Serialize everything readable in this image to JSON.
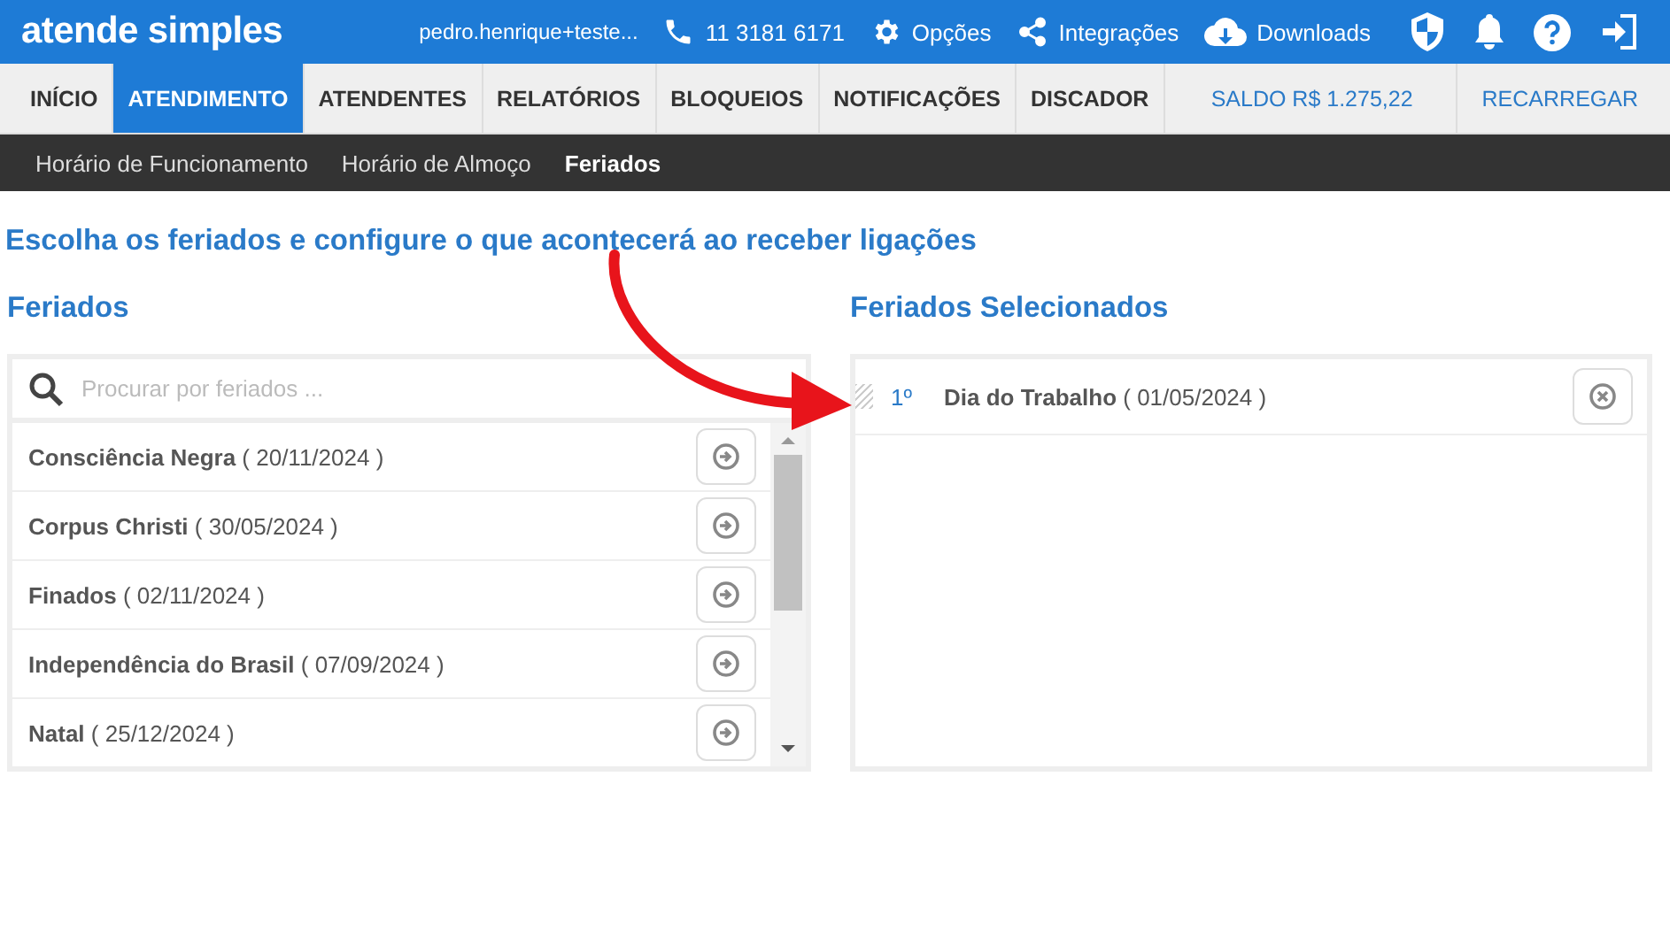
{
  "header": {
    "logo": "atende simples",
    "user": "pedro.henrique+teste...",
    "phone": "11 3181 6171",
    "links": [
      {
        "kind": "options",
        "label": "Opções"
      },
      {
        "kind": "integrations",
        "label": "Integrações"
      },
      {
        "kind": "downloads",
        "label": "Downloads"
      }
    ]
  },
  "nav": {
    "tabs": [
      {
        "label": "INÍCIO",
        "selected": false
      },
      {
        "label": "ATENDIMENTO",
        "selected": true
      },
      {
        "label": "ATENDENTES",
        "selected": false
      },
      {
        "label": "RELATÓRIOS",
        "selected": false
      },
      {
        "label": "BLOQUEIOS",
        "selected": false
      },
      {
        "label": "NOTIFICAÇÕES",
        "selected": false
      },
      {
        "label": "DISCADOR",
        "selected": false
      }
    ],
    "balance": "SALDO R$ 1.275,22",
    "recharge": "RECARREGAR"
  },
  "subnav": [
    {
      "label": "Horário de Funcionamento",
      "selected": false
    },
    {
      "label": "Horário de Almoço",
      "selected": false
    },
    {
      "label": "Feriados",
      "selected": true
    }
  ],
  "heading": "Escolha os feriados e configure o que acontecerá ao receber ligações",
  "holidays": {
    "title": "Feriados",
    "search": {
      "placeholder": "Procurar por feriados ..."
    },
    "items": [
      {
        "name": "Consciência Negra",
        "date": "( 20/11/2024 )"
      },
      {
        "name": "Corpus Christi",
        "date": "( 30/05/2024 )"
      },
      {
        "name": "Finados",
        "date": "( 02/11/2024 )"
      },
      {
        "name": "Independência do Brasil",
        "date": "( 07/09/2024 )"
      },
      {
        "name": "Natal",
        "date": "( 25/12/2024 )"
      }
    ]
  },
  "selected_holidays": {
    "title": "Feriados Selecionados",
    "items": [
      {
        "order": "1º",
        "name": "Dia do Trabalho",
        "date": "( 01/05/2024 )"
      }
    ]
  }
}
